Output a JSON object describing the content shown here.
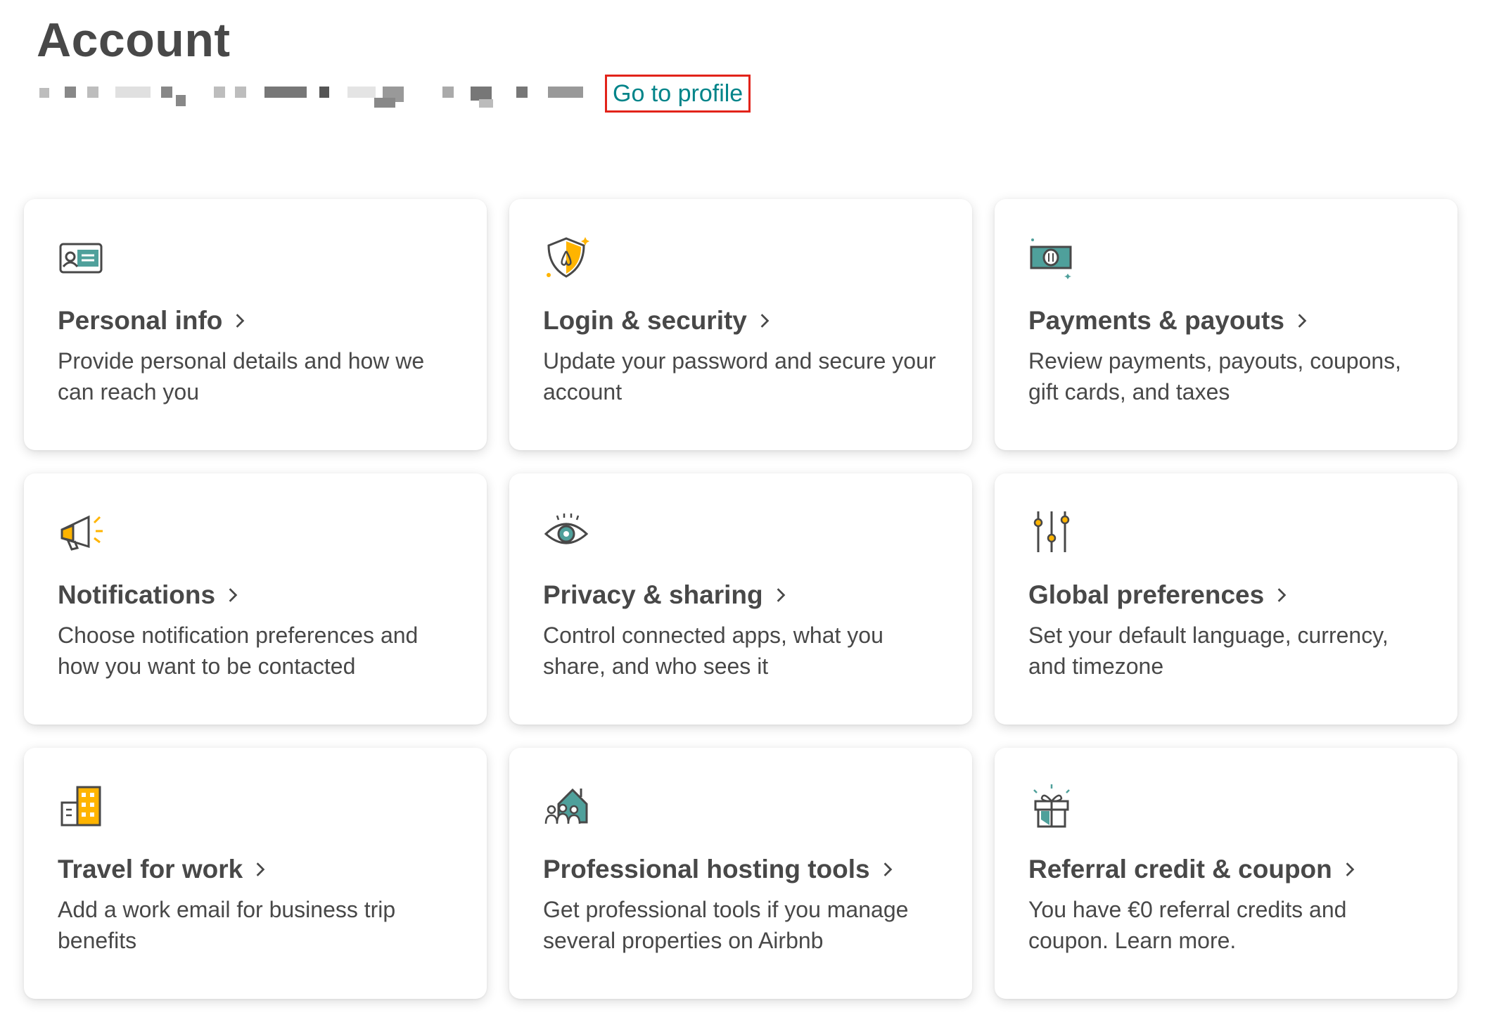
{
  "page": {
    "title": "Account"
  },
  "profile": {
    "link_label": "Go to profile"
  },
  "colors": {
    "accent": "#008489",
    "highlight_box": "#e2231a",
    "icon_yellow": "#ffb400",
    "icon_teal": "#4fa09b"
  },
  "cards": [
    {
      "title": "Personal info",
      "desc": "Provide personal details and how we can reach you",
      "icon": "id-card-icon"
    },
    {
      "title": "Login & security",
      "desc": "Update your password and secure your account",
      "icon": "shield-icon"
    },
    {
      "title": "Payments & payouts",
      "desc": "Review payments, payouts, coupons, gift cards, and taxes",
      "icon": "money-icon"
    },
    {
      "title": "Notifications",
      "desc": "Choose notification preferences and how you want to be contacted",
      "icon": "megaphone-icon"
    },
    {
      "title": "Privacy & sharing",
      "desc": "Control connected apps, what you share, and who sees it",
      "icon": "eye-icon"
    },
    {
      "title": "Global preferences",
      "desc": "Set your default language, currency, and timezone",
      "icon": "sliders-icon"
    },
    {
      "title": "Travel for work",
      "desc": "Add a work email for business trip benefits",
      "icon": "building-icon"
    },
    {
      "title": "Professional hosting tools",
      "desc": "Get professional tools if you manage several properties on Airbnb",
      "icon": "house-people-icon"
    },
    {
      "title": "Referral credit & coupon",
      "desc": "You have €0 referral credits and coupon. Learn more.",
      "icon": "gift-icon"
    }
  ]
}
